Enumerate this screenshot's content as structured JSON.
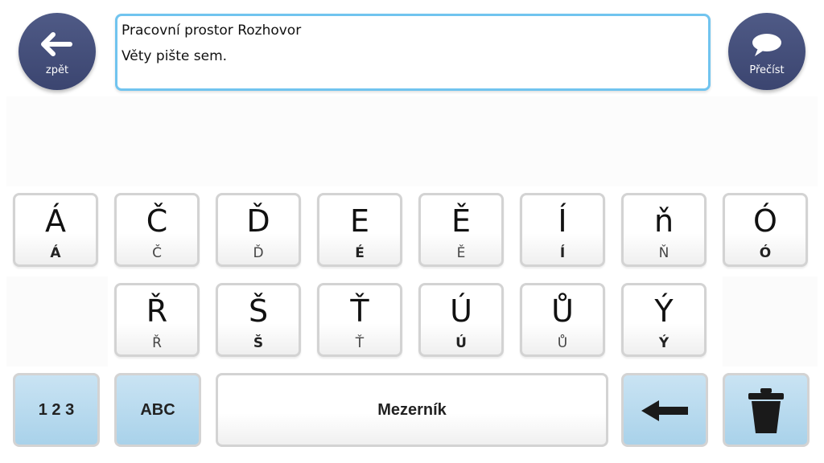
{
  "header": {
    "back_label": "zpět",
    "read_label": "Přečíst",
    "back_icon": "arrow-left-icon",
    "read_icon": "speech-bubble-icon"
  },
  "textbox": {
    "line1": "Pracovní prostor Rozhovor",
    "line2": "Věty pište sem."
  },
  "keys_row1": [
    {
      "main": "Á",
      "sub": "Á",
      "sub_bold": true
    },
    {
      "main": "Č",
      "sub": "Č",
      "sub_bold": false
    },
    {
      "main": "Ď",
      "sub": "Ď",
      "sub_bold": false
    },
    {
      "main": "E",
      "sub": "É",
      "sub_bold": true
    },
    {
      "main": "Ě",
      "sub": "Ě",
      "sub_bold": false
    },
    {
      "main": "Í",
      "sub": "Í",
      "sub_bold": true
    },
    {
      "main": "ň",
      "sub": "Ň",
      "sub_bold": false
    },
    {
      "main": "Ó",
      "sub": "Ó",
      "sub_bold": true
    }
  ],
  "keys_row2": [
    {
      "main": "Ř",
      "sub": "Ř",
      "sub_bold": false
    },
    {
      "main": "Š",
      "sub": "Š",
      "sub_bold": true
    },
    {
      "main": "Ť",
      "sub": "Ť",
      "sub_bold": false
    },
    {
      "main": "Ú",
      "sub": "Ú",
      "sub_bold": true
    },
    {
      "main": "Ů",
      "sub": "Ů",
      "sub_bold": false
    },
    {
      "main": "Ý",
      "sub": "Ý",
      "sub_bold": true
    }
  ],
  "bottom_row": {
    "numbers_label": "1 2 3",
    "abc_label": "ABC",
    "space_label": "Mezerník",
    "backspace_icon": "backspace-arrow-icon",
    "delete_icon": "trash-icon"
  },
  "colors": {
    "round_button": "#45507c",
    "textbox_border": "#71c4ef",
    "function_key": "#b6d9ee"
  }
}
